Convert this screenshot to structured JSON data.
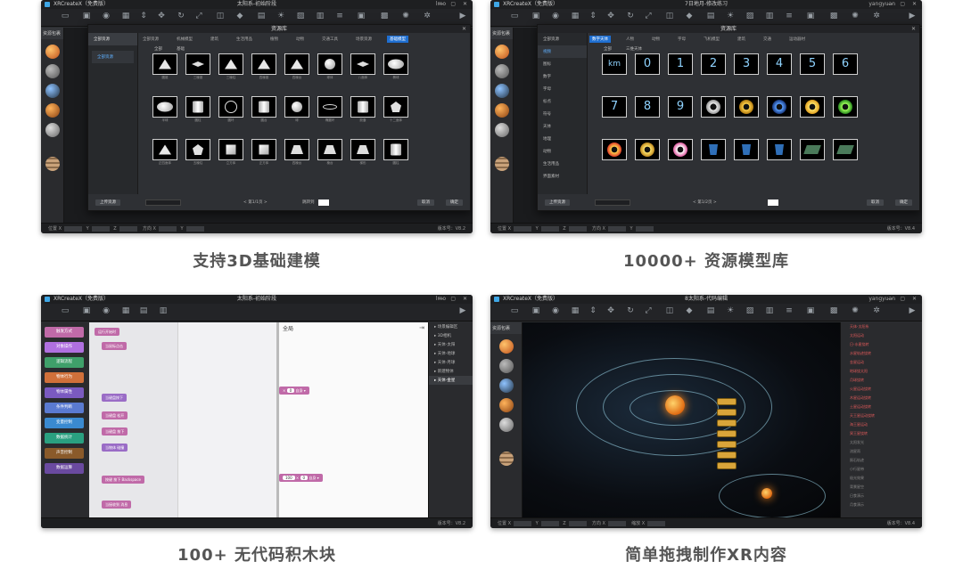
{
  "app_name": "XRCreateX（免费版）",
  "captions": [
    "支持3D基础建模",
    "10000+ 资源模型库",
    "100+ 无代码积木块",
    "简单拖拽制作XR内容"
  ],
  "colors": {
    "accent_blue": "#1f6fd1",
    "block_pink": "#c06aa8",
    "orbit": "#a0dcf0",
    "code_block": "#d9a53a"
  },
  "panel1": {
    "doc_title": "太阳系-初始阶段",
    "user": "lmo",
    "nav_header": "资源包裹",
    "dialog_title": "资源库",
    "sidebar_selected": "全部资源",
    "tabs": [
      "全部资源",
      "机械模型",
      "建筑",
      "生活用品",
      "植物",
      "动物",
      "交通工具",
      "场景资源",
      "基础模型"
    ],
    "subtabs": [
      "全部",
      "基础"
    ],
    "shapes": [
      "tri",
      "dia",
      "tri",
      "tri",
      "tri",
      "sph",
      "dia",
      "ell",
      "ell",
      "cyl",
      "ring",
      "cyl",
      "sph",
      "thin-ell",
      "cyl",
      "pent",
      "tri",
      "pent",
      "box",
      "box",
      "trap",
      "trap",
      "trap",
      "cyl"
    ],
    "captions": [
      "圆锥",
      "三棱锥",
      "三棱柱",
      "四棱锥",
      "四棱台",
      "球体",
      "八面体",
      "椭球",
      "半球",
      "圆柱",
      "圆环",
      "圆台",
      "球",
      "椭圆环",
      "胶囊",
      "十二面体",
      "正四面体",
      "五棱柱",
      "立方体",
      "正方体",
      "四棱台",
      "棱台",
      "梯形",
      "圆柱"
    ],
    "footer_btn_left": "上传资源",
    "search_placeholder": "搜索",
    "pager": "< 第1/1页 >",
    "page_size_label": "跳转到",
    "btn_cancel": "取消",
    "btn_ok": "确定",
    "ver": "版本号：V8.2"
  },
  "panel2": {
    "doc_title": "7日地月-修改练习",
    "user": "yangyuan",
    "nav_header": "资源包裹",
    "dialog_title": "资源库",
    "sidebar": [
      "全部资源",
      "视频",
      "图标",
      "数字",
      "字母",
      "标点",
      "符号",
      "天体",
      "地理",
      "动物",
      "生活用品",
      "界面素材"
    ],
    "sidebar_selected_index": 1,
    "tabs": [
      "数字天体",
      "人物",
      "动物",
      "字母",
      "飞机模型",
      "建筑",
      "交通",
      "运动器材"
    ],
    "subtabs": [
      "全部",
      "三维天体"
    ],
    "labels": [
      "km",
      "0",
      "1",
      "2",
      "3",
      "4",
      "5",
      "6",
      "7",
      "8",
      "9"
    ],
    "footer_btn_left": "上传资源",
    "pager": "< 第1/2页 >",
    "btn_cancel": "取消",
    "btn_ok": "确定",
    "ver": "版本号：V8.4"
  },
  "panel3": {
    "doc_title": "太阳系-初始阶段",
    "user": "lmo",
    "categories": [
      "触发方式",
      "对象操作",
      "逻辑流程",
      "物体行为",
      "物体属性",
      "条件判断",
      "变量控制",
      "数据统计",
      "声音控制",
      "数据运算"
    ],
    "blocks": [
      "运行开始时",
      "当鼠标点击",
      "当键盘按下",
      "当键盘 松开",
      "当键盘 按下",
      "当物体 碰撞",
      "按键 按下 Backspace",
      "当接收到 消息"
    ],
    "work_label": "全局",
    "work_blocks": [
      "0",
      "自身",
      "100",
      "0",
      "自身"
    ],
    "tree": [
      "场景编辑区",
      "3D相机",
      "天体-太阳",
      "天体-地球",
      "天体-月球",
      "新建物体",
      "天体-金星"
    ],
    "ver": "版本号：V8.2"
  },
  "panel4": {
    "doc_title": "8太阳系-代码编辑",
    "user": "yangyuan",
    "nav_header": "资源包裹",
    "list": [
      "天体-太阳系",
      "太阳运动",
      "日-水星绕转",
      "水星轨迹绕转",
      "金星运动",
      "地球绕太阳",
      "月球绕转",
      "火星运动绕转",
      "木星运动绕转",
      "土星运动绕转",
      "天王星运动绕转",
      "海王星运动",
      "冥王星绕转",
      "太阳发光",
      "流星雨",
      "陨石轨迹",
      "小行星带",
      "极光效果",
      "背景星空",
      "日食演示",
      "月食演示"
    ],
    "ver": "版本号：V8.4"
  },
  "statusbar": {
    "pos_label": "位置",
    "rot_label": "方向",
    "scale_label": "缩放"
  }
}
